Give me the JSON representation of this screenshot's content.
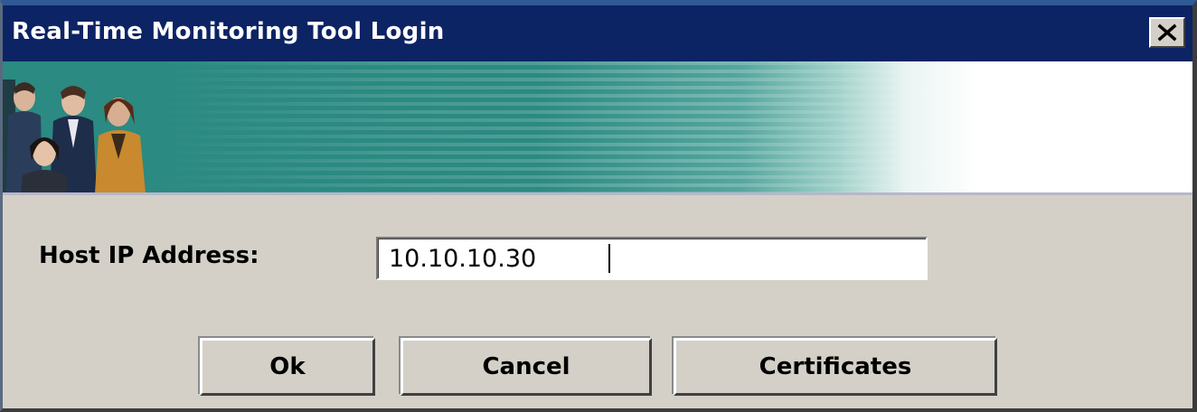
{
  "window": {
    "title": "Real-Time Monitoring Tool Login"
  },
  "form": {
    "host_label": "Host IP Address:",
    "host_value": "10.10.10.30"
  },
  "buttons": {
    "ok": "Ok",
    "cancel": "Cancel",
    "certificates": "Certificates"
  },
  "icons": {
    "close": "close-icon",
    "banner": "people-banner-image"
  },
  "colors": {
    "titlebar": "#0c2364",
    "banner_teal": "#2b8a82",
    "dialog_bg": "#d4d0c8"
  }
}
